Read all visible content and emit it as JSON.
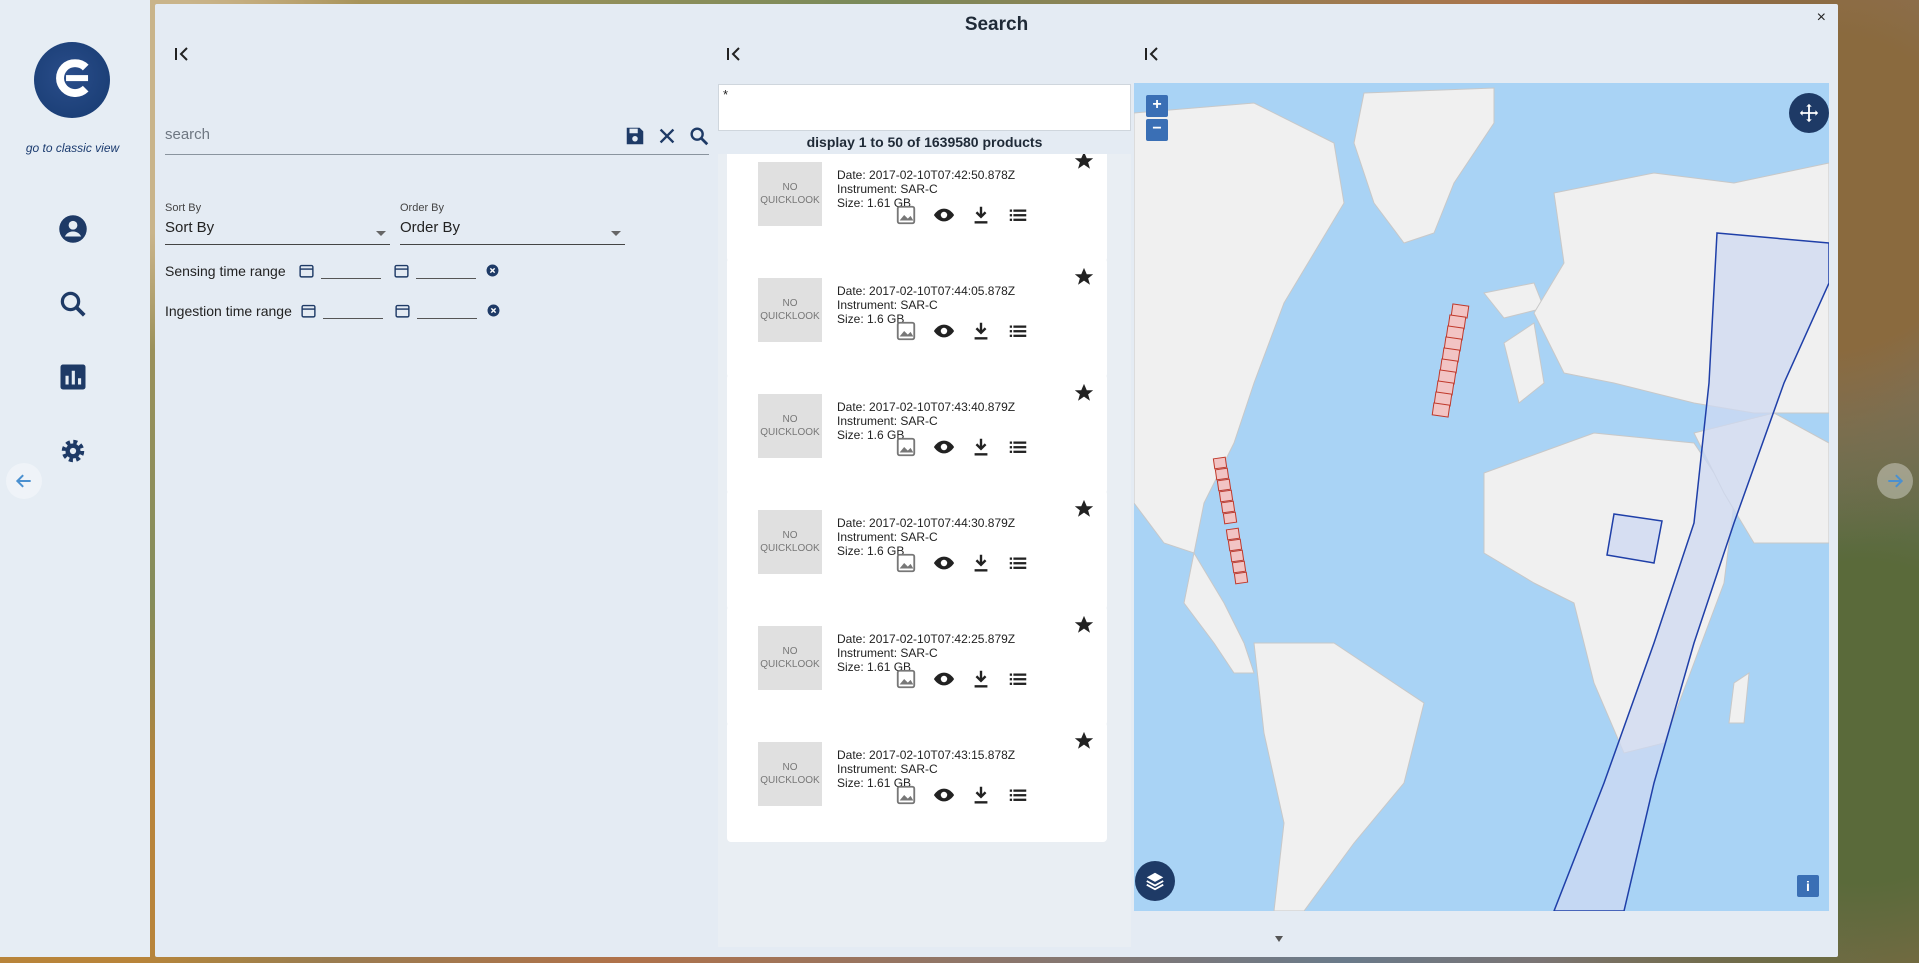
{
  "window": {
    "title": "Search",
    "close_label": "×"
  },
  "sidebar": {
    "classic_view_link": "go to classic view",
    "icons": [
      "user-icon",
      "search-icon",
      "stats-icon",
      "settings-icon"
    ]
  },
  "filters": {
    "search_placeholder": "search",
    "sort_by_label": "Sort By",
    "sort_by_value": "Sort By",
    "order_by_label": "Order By",
    "order_by_value": "Order By",
    "sensing_range_label": "Sensing time range",
    "ingestion_range_label": "Ingestion time range"
  },
  "results": {
    "query_text": "*",
    "display_text": "display 1 to 50 of 1639580 products",
    "no_quicklook_line1": "NO",
    "no_quicklook_line2": "QUICKLOOK",
    "items": [
      {
        "date": "Date: 2017-02-10T07:42:50.878Z",
        "instrument": "Instrument: SAR-C",
        "size": "Size: 1.61 GB"
      },
      {
        "date": "Date: 2017-02-10T07:44:05.878Z",
        "instrument": "Instrument: SAR-C",
        "size": "Size: 1.6 GB"
      },
      {
        "date": "Date: 2017-02-10T07:43:40.879Z",
        "instrument": "Instrument: SAR-C",
        "size": "Size: 1.6 GB"
      },
      {
        "date": "Date: 2017-02-10T07:44:30.879Z",
        "instrument": "Instrument: SAR-C",
        "size": "Size: 1.6 GB"
      },
      {
        "date": "Date: 2017-02-10T07:42:25.879Z",
        "instrument": "Instrument: SAR-C",
        "size": "Size: 1.61 GB"
      },
      {
        "date": "Date: 2017-02-10T07:43:15.878Z",
        "instrument": "Instrument: SAR-C",
        "size": "Size: 1.61 GB"
      }
    ]
  },
  "map": {
    "zoom_in": "+",
    "zoom_out": "−",
    "info": "i"
  },
  "colors": {
    "accent": "#1e3a66",
    "footprint_red": "#c0392b",
    "footprint_blue": "#1f3fa8",
    "ocean": "#a9d3f5",
    "land": "#f0f0f0"
  }
}
